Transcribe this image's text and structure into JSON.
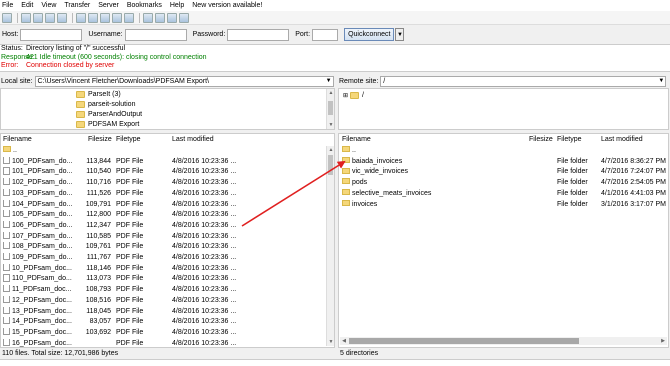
{
  "menu": [
    "File",
    "Edit",
    "View",
    "Transfer",
    "Server",
    "Bookmarks",
    "Help",
    "New version available!"
  ],
  "quickconnect": {
    "host_label": "Host:",
    "host_value": "",
    "username_label": "Username:",
    "username_value": "",
    "password_label": "Password:",
    "password_value": "",
    "port_label": "Port:",
    "port_value": "",
    "button_label": "Quickconnect",
    "dropdown_glyph": "▼"
  },
  "log": [
    {
      "label": "Status:",
      "text": "Directory listing of \"/\" successful",
      "kind": "status"
    },
    {
      "label": "Response:",
      "text": "421 Idle timeout (600 seconds): closing control connection",
      "kind": "resp"
    },
    {
      "label": "Error:",
      "text": "Connection closed by server",
      "kind": "err"
    }
  ],
  "local": {
    "site_label": "Local site:",
    "path": "C:\\Users\\Vincent Fletcher\\Downloads\\PDFSAM Export\\",
    "tree": [
      "ParseIt (3)",
      "parseit-solution",
      "ParserAndOutput",
      "PDFSAM Export"
    ],
    "columns": {
      "name": "Filename",
      "size": "Filesize",
      "type": "Filetype",
      "modified": "Last modified"
    },
    "parent_row": "..",
    "files": [
      {
        "name": "100_PDFsam_do...",
        "size": "113,844",
        "type": "PDF File",
        "modified": "4/8/2016 10:23:36 ..."
      },
      {
        "name": "101_PDFsam_do...",
        "size": "110,540",
        "type": "PDF File",
        "modified": "4/8/2016 10:23:36 ..."
      },
      {
        "name": "102_PDFsam_do...",
        "size": "110,716",
        "type": "PDF File",
        "modified": "4/8/2016 10:23:36 ..."
      },
      {
        "name": "103_PDFsam_do...",
        "size": "111,526",
        "type": "PDF File",
        "modified": "4/8/2016 10:23:36 ..."
      },
      {
        "name": "104_PDFsam_do...",
        "size": "109,791",
        "type": "PDF File",
        "modified": "4/8/2016 10:23:36 ..."
      },
      {
        "name": "105_PDFsam_do...",
        "size": "112,800",
        "type": "PDF File",
        "modified": "4/8/2016 10:23:36 ..."
      },
      {
        "name": "106_PDFsam_do...",
        "size": "112,347",
        "type": "PDF File",
        "modified": "4/8/2016 10:23:36 ..."
      },
      {
        "name": "107_PDFsam_do...",
        "size": "110,585",
        "type": "PDF File",
        "modified": "4/8/2016 10:23:36 ..."
      },
      {
        "name": "108_PDFsam_do...",
        "size": "109,761",
        "type": "PDF File",
        "modified": "4/8/2016 10:23:36 ..."
      },
      {
        "name": "109_PDFsam_do...",
        "size": "111,767",
        "type": "PDF File",
        "modified": "4/8/2016 10:23:36 ..."
      },
      {
        "name": "10_PDFsam_doc...",
        "size": "118,146",
        "type": "PDF File",
        "modified": "4/8/2016 10:23:36 ..."
      },
      {
        "name": "110_PDFsam_do...",
        "size": "113,073",
        "type": "PDF File",
        "modified": "4/8/2016 10:23:36 ..."
      },
      {
        "name": "11_PDFsam_doc...",
        "size": "108,793",
        "type": "PDF File",
        "modified": "4/8/2016 10:23:36 ..."
      },
      {
        "name": "12_PDFsam_doc...",
        "size": "108,516",
        "type": "PDF File",
        "modified": "4/8/2016 10:23:36 ..."
      },
      {
        "name": "13_PDFsam_doc...",
        "size": "118,045",
        "type": "PDF File",
        "modified": "4/8/2016 10:23:36 ..."
      },
      {
        "name": "14_PDFsam_doc...",
        "size": "83,057",
        "type": "PDF File",
        "modified": "4/8/2016 10:23:36 ..."
      },
      {
        "name": "15_PDFsam_doc...",
        "size": "103,692",
        "type": "PDF File",
        "modified": "4/8/2016 10:23:36 ..."
      },
      {
        "name": "16_PDFsam_doc...",
        "size": "",
        "type": "PDF File",
        "modified": "4/8/2016 10:23:36 ..."
      }
    ],
    "status": "110 files. Total size: 12,701,986 bytes"
  },
  "remote": {
    "site_label": "Remote site:",
    "path": "/",
    "tree_root": "/",
    "columns": {
      "name": "Filename",
      "size": "Filesize",
      "type": "Filetype",
      "modified": "Last modified"
    },
    "parent_row": "..",
    "files": [
      {
        "name": "baiada_invoices",
        "size": "",
        "type": "File folder",
        "modified": "4/7/2016 8:36:27 PM"
      },
      {
        "name": "vic_wide_invoices",
        "size": "",
        "type": "File folder",
        "modified": "4/7/2016 7:24:07 PM"
      },
      {
        "name": "pods",
        "size": "",
        "type": "File folder",
        "modified": "4/7/2016 2:54:05 PM"
      },
      {
        "name": "selective_meats_invoices",
        "size": "",
        "type": "File folder",
        "modified": "4/1/2016 4:41:03 PM"
      },
      {
        "name": "invoices",
        "size": "",
        "type": "File folder",
        "modified": "3/1/2016 3:17:07 PM"
      }
    ],
    "status": "5 directories"
  },
  "colors": {
    "response": "#008000",
    "error": "#e00000",
    "annotation_arrow": "#e02020",
    "folder": "#f5d77a"
  },
  "icons": {
    "scroll_up": "▲",
    "scroll_down": "▼",
    "scroll_left": "◀",
    "scroll_right": "▶",
    "dropdown": "▼",
    "tree_expand": "⊞"
  }
}
